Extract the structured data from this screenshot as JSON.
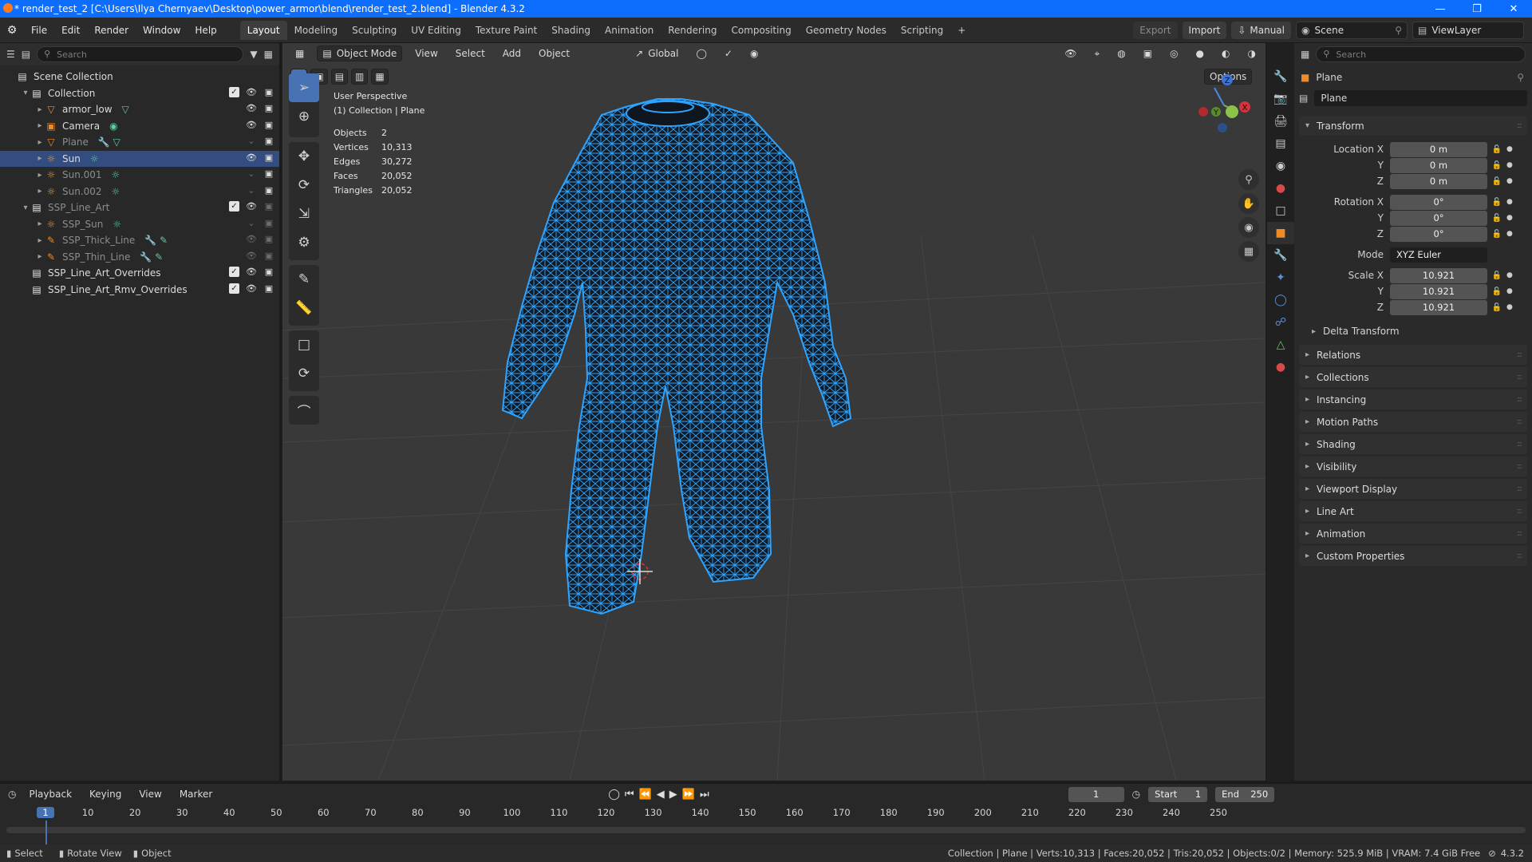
{
  "window": {
    "title": "* render_test_2 [C:\\Users\\Ilya Chernyaev\\Desktop\\power_armor\\blend\\render_test_2.blend] - Blender 4.3.2",
    "controls": [
      "minimize-icon",
      "maximize-icon",
      "close-icon"
    ]
  },
  "menu": [
    "File",
    "Edit",
    "Render",
    "Window",
    "Help"
  ],
  "workspaces": {
    "active": "Layout",
    "tabs": [
      "Layout",
      "Modeling",
      "Sculpting",
      "UV Editing",
      "Texture Paint",
      "Shading",
      "Animation",
      "Rendering",
      "Compositing",
      "Geometry Nodes",
      "Scripting"
    ],
    "add": "+"
  },
  "topright": {
    "export": "Export",
    "import": "Import",
    "manual": "Manual",
    "scene": "Scene",
    "view_layer": "ViewLayer"
  },
  "outliner": {
    "search_placeholder": "Search",
    "items": [
      {
        "name": "Scene Collection",
        "depth": 0,
        "type": "scene"
      },
      {
        "name": "Collection",
        "depth": 1,
        "type": "collection"
      },
      {
        "name": "armor_low",
        "depth": 2,
        "type": "mesh"
      },
      {
        "name": "Camera",
        "depth": 2,
        "type": "camera"
      },
      {
        "name": "Plane",
        "depth": 2,
        "type": "mesh",
        "dim": true
      },
      {
        "name": "Sun",
        "depth": 2,
        "type": "light",
        "selected": true
      },
      {
        "name": "Sun.001",
        "depth": 2,
        "type": "light",
        "dim": true
      },
      {
        "name": "Sun.002",
        "depth": 2,
        "type": "light",
        "dim": true
      },
      {
        "name": "SSP_Line_Art",
        "depth": 1,
        "type": "collection",
        "dim": true
      },
      {
        "name": "SSP_Sun",
        "depth": 2,
        "type": "light",
        "dim": true
      },
      {
        "name": "SSP_Thick_Line",
        "depth": 2,
        "type": "gpencil",
        "dim": true
      },
      {
        "name": "SSP_Thin_Line",
        "depth": 2,
        "type": "gpencil",
        "dim": true
      },
      {
        "name": "SSP_Line_Art_Overrides",
        "depth": 1,
        "type": "collection"
      },
      {
        "name": "SSP_Line_Art_Rmv_Overrides",
        "depth": 1,
        "type": "collection"
      }
    ]
  },
  "viewport": {
    "mode": "Object Mode",
    "menus": [
      "View",
      "Select",
      "Add",
      "Object"
    ],
    "transform_orientation": "Global",
    "options": "Options",
    "perspective": "User Perspective",
    "context": "(1) Collection | Plane",
    "stats": [
      {
        "k": "Objects",
        "v": "2"
      },
      {
        "k": "Vertices",
        "v": "10,313"
      },
      {
        "k": "Edges",
        "v": "30,272"
      },
      {
        "k": "Faces",
        "v": "20,052"
      },
      {
        "k": "Triangles",
        "v": "20,052"
      }
    ],
    "gizmo": {
      "x": "X",
      "y": "Y",
      "z": "Z"
    },
    "wire_color": "#2fa4ff"
  },
  "properties": {
    "object_name": "Plane",
    "datablock_name": "Plane",
    "transform_label": "Transform",
    "location": {
      "label": "Location X",
      "x": "0 m",
      "y": "0 m",
      "z": "0 m"
    },
    "rotation": {
      "label": "Rotation X",
      "x": "0°",
      "y": "0°",
      "z": "0°"
    },
    "mode": {
      "label": "Mode",
      "value": "XYZ Euler"
    },
    "scale": {
      "label": "Scale X",
      "x": "10.921",
      "y": "10.921",
      "z": "10.921"
    },
    "axis_y": "Y",
    "axis_z": "Z",
    "delta": "Delta Transform",
    "panels": [
      "Relations",
      "Collections",
      "Instancing",
      "Motion Paths",
      "Shading",
      "Visibility",
      "Viewport Display",
      "Line Art",
      "Animation",
      "Custom Properties"
    ]
  },
  "timeline": {
    "menus": [
      "Playback",
      "Keying",
      "View",
      "Marker"
    ],
    "current_frame": "1",
    "start_label": "Start",
    "start": "1",
    "end_label": "End",
    "end": "250",
    "ticks": [
      "1",
      "10",
      "20",
      "30",
      "40",
      "50",
      "60",
      "70",
      "80",
      "90",
      "100",
      "110",
      "120",
      "130",
      "140",
      "150",
      "160",
      "170",
      "180",
      "190",
      "200",
      "210",
      "220",
      "230",
      "240",
      "250"
    ]
  },
  "status": {
    "select": "Select",
    "rotate": "Rotate View",
    "object": "Object",
    "info": "Collection | Plane | Verts:10,313 | Faces:20,052 | Tris:20,052 | Objects:0/2 | Memory: 525.9 MiB | VRAM: 7.4 GiB Free",
    "version": "4.3.2"
  }
}
